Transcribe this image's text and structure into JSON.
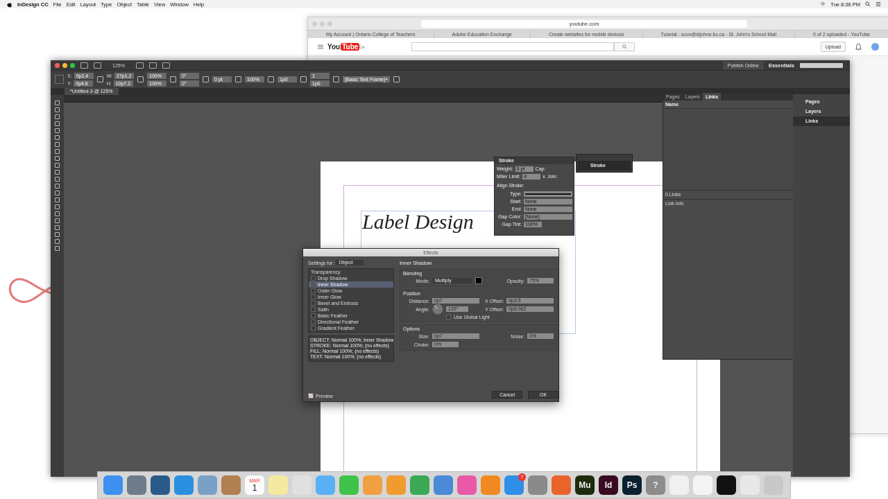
{
  "menu_bar": {
    "app": "InDesign CC",
    "menus": [
      "File",
      "Edit",
      "Layout",
      "Type",
      "Object",
      "Table",
      "View",
      "Window",
      "Help"
    ],
    "clock": "Tue 8:36 PM"
  },
  "browser": {
    "url": "youtube.com",
    "tabs": [
      {
        "label": "My Account | Ontario College of Teachers"
      },
      {
        "label": "Adobe Education Exchange"
      },
      {
        "label": "Create websites for mobile devices"
      },
      {
        "label": "Tutorial - scox@stjohns.bc.ca - St. John's School Mail"
      },
      {
        "label": "0 of 2 uploaded - YouTube"
      }
    ],
    "logo_word": "You",
    "logo_box": "Tube",
    "logo_region": "CA",
    "upload_button": "Upload"
  },
  "indesign": {
    "zoom": "125%",
    "publish_button": "Publish Online",
    "workspace": "Essentials",
    "control_bar": [
      [
        {
          "label": "X:",
          "value": "0p2.4"
        },
        {
          "label": "Y:",
          "value": "0p4.6"
        }
      ],
      [
        {
          "label": "W:",
          "value": "27p1.2"
        },
        {
          "label": "H:",
          "value": "10p7.2"
        }
      ],
      [
        {
          "value": "100%"
        },
        {
          "value": "100%"
        }
      ],
      [
        {
          "value": "0°"
        },
        {
          "value": "0°"
        }
      ],
      [
        {
          "value": "0 pt"
        }
      ],
      [
        {
          "value": "100%"
        }
      ],
      [
        {
          "value": "1p0"
        }
      ],
      [
        {
          "value": "1"
        },
        {
          "value": "1p0"
        }
      ],
      [
        {
          "value": "[Basic Text Frame]+"
        }
      ]
    ],
    "document_tab": "*Untitled-3 @ 125%",
    "page_text": "Label Design",
    "links_panel": {
      "tabs": [
        {
          "label": "Pages",
          "selected": false
        },
        {
          "label": "Layers",
          "selected": false
        },
        {
          "label": "Links",
          "selected": true
        }
      ],
      "name_column": "Name",
      "count": "0 Links",
      "link_info": "Link Info"
    },
    "panel_dock": [
      {
        "label": "Pages",
        "selected": false
      },
      {
        "label": "Layers",
        "selected": false
      },
      {
        "label": "Links",
        "selected": true
      }
    ],
    "stroke_panel": {
      "title": "Stroke",
      "weight_label": "Weight:",
      "weight": "0 pt",
      "cap_label": "Cap:",
      "miter_label": "Miter Limit:",
      "miter": "4",
      "times": "x",
      "join_label": "Join:",
      "align_label": "Align Stroke:",
      "type_label": "Type:",
      "start_label": "Start:",
      "start": "None",
      "end_label": "End:",
      "end": "None",
      "gap_color_label": "Gap Color:",
      "gap_color": "[None]",
      "gap_tint_label": "Gap Tint:",
      "gap_tint": "100%"
    },
    "collapsed_panel": "Stroke"
  },
  "effects_dialog": {
    "title": "Effects",
    "settings_label": "Settings for:",
    "settings_value": "Object",
    "heading": "Inner Shadow",
    "list_header": "Transparency",
    "effects": [
      {
        "label": "Drop Shadow",
        "checked": false,
        "selected": false
      },
      {
        "label": "Inner Shadow",
        "checked": true,
        "selected": true
      },
      {
        "label": "Outer Glow",
        "checked": false,
        "selected": false
      },
      {
        "label": "Inner Glow",
        "checked": false,
        "selected": false
      },
      {
        "label": "Bevel and Emboss",
        "checked": false,
        "selected": false
      },
      {
        "label": "Satin",
        "checked": false,
        "selected": false
      },
      {
        "label": "Basic Feather",
        "checked": false,
        "selected": false
      },
      {
        "label": "Directional Feather",
        "checked": false,
        "selected": false
      },
      {
        "label": "Gradient Feather",
        "checked": false,
        "selected": false
      }
    ],
    "summary": [
      "OBJECT: Normal 100%; Inner Shadow",
      "STROKE: Normal 100%; (no effects)",
      "FILL: Normal 100%; (no effects)",
      "TEXT: Normal 100%; (no effects)"
    ],
    "blending": {
      "title": "Blending",
      "mode_label": "Mode:",
      "mode": "Multiply",
      "opacity_label": "Opacity:",
      "opacity": "75%"
    },
    "position": {
      "title": "Position",
      "distance_label": "Distance:",
      "distance": "0p7",
      "angle_label": "Angle:",
      "angle": "120°",
      "global_light_label": "Use Global Light",
      "global_light": false,
      "x_label": "X Offset:",
      "x": "0p3.5",
      "y_label": "Y Offset:",
      "y": "0p6.062"
    },
    "options": {
      "title": "Options",
      "size_label": "Size:",
      "size": "0p7",
      "noise_label": "Noise:",
      "noise": "0%",
      "choke_label": "Choke:",
      "choke": "0%"
    },
    "preview_label": "Preview",
    "preview": true,
    "cancel": "Cancel",
    "ok": "OK"
  },
  "dock": [
    {
      "kind": "tile",
      "color": "#3d8ff0"
    },
    {
      "kind": "tile",
      "color": "#6d7b8a"
    },
    {
      "kind": "tile",
      "color": "#2a5a8a"
    },
    {
      "kind": "tile",
      "color": "#2b8fe0"
    },
    {
      "kind": "tile",
      "color": "#7aa0c8"
    },
    {
      "kind": "tile",
      "color": "#b08050"
    },
    {
      "kind": "calendar",
      "color": "#fafafa",
      "month": "MAR",
      "day": "1"
    },
    {
      "kind": "tile",
      "color": "#f5e9a0"
    },
    {
      "kind": "tile",
      "color": "#e0e0e0"
    },
    {
      "kind": "tile",
      "color": "#5ab0f5"
    },
    {
      "kind": "tile",
      "color": "#3fc24a"
    },
    {
      "kind": "tile",
      "color": "#f0a040"
    },
    {
      "kind": "tile",
      "color": "#f09a30"
    },
    {
      "kind": "tile",
      "color": "#3aa855"
    },
    {
      "kind": "tile",
      "color": "#4a8ad8"
    },
    {
      "kind": "tile",
      "color": "#e85aa8"
    },
    {
      "kind": "tile",
      "color": "#f08a20"
    },
    {
      "kind": "badge",
      "color": "#2f8fe8",
      "badge": "7"
    },
    {
      "kind": "tile",
      "color": "#8a8a8a"
    },
    {
      "kind": "tile",
      "color": "#e8642a"
    },
    {
      "kind": "text",
      "color": "#1e2a0c",
      "label": "Mu"
    },
    {
      "kind": "text",
      "color": "#3a0a20",
      "label": "Id"
    },
    {
      "kind": "text",
      "color": "#0a2030",
      "label": "Ps"
    },
    {
      "kind": "text",
      "color": "#8c8c8c",
      "label": "?"
    },
    {
      "kind": "tile",
      "color": "#f0f0f0"
    },
    {
      "kind": "tile",
      "color": "#f4f4f4"
    },
    {
      "kind": "tile",
      "color": "#111111"
    },
    {
      "kind": "tile",
      "color": "#e8e8e8"
    },
    {
      "kind": "tile",
      "color": "#c8c8c8"
    }
  ]
}
